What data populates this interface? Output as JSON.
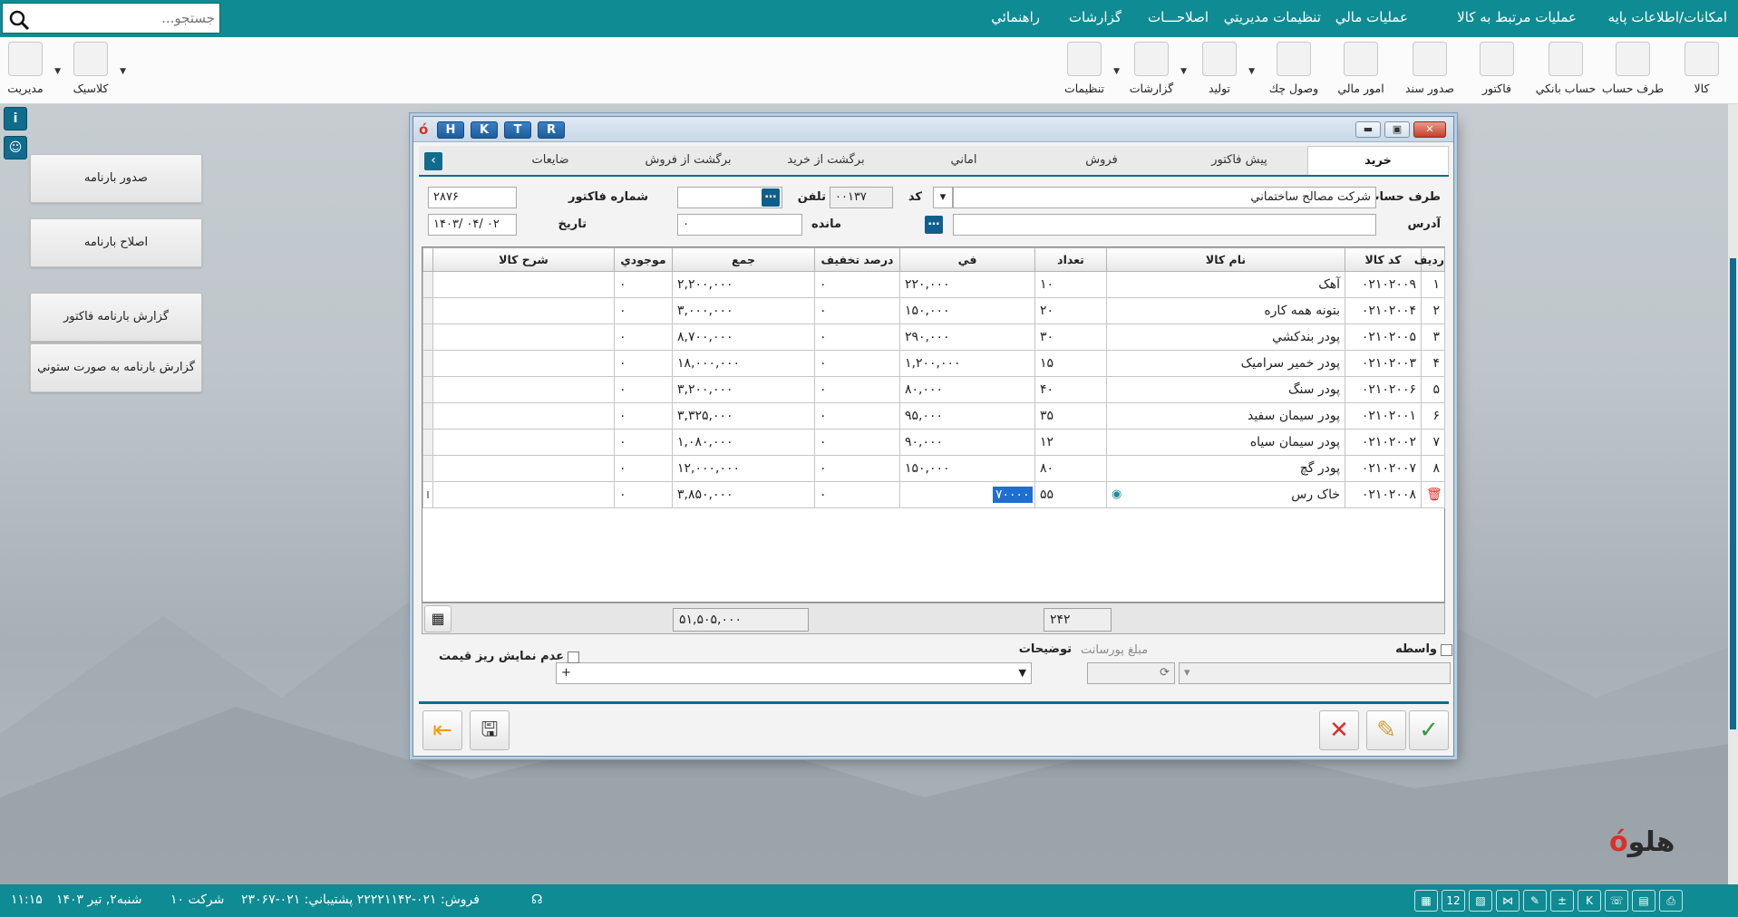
{
  "menu": {
    "items": [
      "امکانات/اطلاعات پايه",
      "عمليات مرتبط به کالا",
      "عمليات مالي",
      "تنظيمات مديريتي",
      "اصلاحـــات",
      "گزارشات",
      "راهنمائي"
    ],
    "search_placeholder": "جستجو..."
  },
  "toolbar": {
    "items": [
      "کالا",
      "طرف حساب",
      "حساب بانکي",
      "فاکتور",
      "صدور سند",
      "امور مالي",
      "وصول چك",
      "توليد",
      "گزارشات",
      "تنظيمات"
    ],
    "left": [
      "مديريت",
      "کلاسيک"
    ]
  },
  "sidebar": {
    "buttons": [
      "صدور بارنامه",
      "اصلاح بارنامه",
      "گزارش بارنامه فاکتور",
      "گزارش بارنامه به صورت ستوني"
    ]
  },
  "window": {
    "hotkeys": [
      "H",
      "K",
      "T",
      "R"
    ],
    "tabs": [
      "خريد",
      "پيش فاکتور",
      "فروش",
      "اماني",
      "برگشت از خريد",
      "برگشت از فروش",
      "ضايعات"
    ],
    "active_tab": "خريد"
  },
  "form": {
    "party_label": "طرف حساب",
    "party_value": "شرکت مصالح ساختماني",
    "code_label": "کد",
    "code_value": "۰۰۱۳۷",
    "phone_label": "تلفن",
    "phone_value": "",
    "address_label": "آدرس",
    "address_value": "",
    "balance_label": "مانده",
    "balance_value": "۰",
    "invoice_no_label": "شماره فاکتور",
    "invoice_no_value": "۲۸۷۶",
    "date_label": "تاريخ",
    "date_value": "۱۴۰۳/ ۰۴/ ۰۲"
  },
  "grid": {
    "columns": [
      "رديف",
      "کد کالا",
      "نام کالا",
      "تعداد",
      "في",
      "درصد تخفيف",
      "جمع",
      "موجودي",
      "شرح کالا"
    ],
    "rows": [
      [
        "۱",
        "۰۲۱۰۲۰۰۹",
        "آهک",
        "۱۰",
        "۲۲۰,۰۰۰",
        "۰",
        "۲,۲۰۰,۰۰۰",
        "۰",
        ""
      ],
      [
        "۲",
        "۰۲۱۰۲۰۰۴",
        "بتونه همه کاره",
        "۲۰",
        "۱۵۰,۰۰۰",
        "۰",
        "۳,۰۰۰,۰۰۰",
        "۰",
        ""
      ],
      [
        "۳",
        "۰۲۱۰۲۰۰۵",
        "پودر بندکشي",
        "۳۰",
        "۲۹۰,۰۰۰",
        "۰",
        "۸,۷۰۰,۰۰۰",
        "۰",
        ""
      ],
      [
        "۴",
        "۰۲۱۰۲۰۰۳",
        "پودر خمير سراميک",
        "۱۵",
        "۱,۲۰۰,۰۰۰",
        "۰",
        "۱۸,۰۰۰,۰۰۰",
        "۰",
        ""
      ],
      [
        "۵",
        "۰۲۱۰۲۰۰۶",
        "پودر سنگ",
        "۴۰",
        "۸۰,۰۰۰",
        "۰",
        "۳,۲۰۰,۰۰۰",
        "۰",
        ""
      ],
      [
        "۶",
        "۰۲۱۰۲۰۰۱",
        "پودر سيمان سفيد",
        "۳۵",
        "۹۵,۰۰۰",
        "۰",
        "۳,۳۲۵,۰۰۰",
        "۰",
        ""
      ],
      [
        "۷",
        "۰۲۱۰۲۰۰۲",
        "پودر سيمان سياه",
        "۱۲",
        "۹۰,۰۰۰",
        "۰",
        "۱,۰۸۰,۰۰۰",
        "۰",
        ""
      ],
      [
        "۸",
        "۰۲۱۰۲۰۰۷",
        "پودر گچ",
        "۸۰",
        "۱۵۰,۰۰۰",
        "۰",
        "۱۲,۰۰۰,۰۰۰",
        "۰",
        ""
      ],
      [
        "",
        "۰۲۱۰۲۰۰۸",
        "خاک رس",
        "۵۵",
        "۷۰۰۰۰",
        "۰",
        "۳,۸۵۰,۰۰۰",
        "۰",
        ""
      ]
    ],
    "total_qty": "۲۴۲",
    "total_sum": "۵۱,۵۰۵,۰۰۰"
  },
  "bottom": {
    "intermediary_label": "واسطه",
    "commission_label": "مبلغ پورسانت",
    "notes_label": "توضيحات",
    "notes_value": "+",
    "hide_price_label": "عدم نمايش ريز قيمت"
  },
  "status": {
    "datetime": "شنبه۲, تير ۱۴۰۳",
    "time": "۱۱:۱۵",
    "company": "شرکت ۱۰",
    "support": "فروش:  ۰۲۱-۲۲۲۲۱۱۴۲  پشتيباني:  ۰۲۱-۲۳۰۶۷"
  },
  "brand": "هلو",
  "colors": {
    "teal": "#0f8b93",
    "blue": "#0f6c8c",
    "red": "#d9302a",
    "green": "#2e9c3f"
  }
}
